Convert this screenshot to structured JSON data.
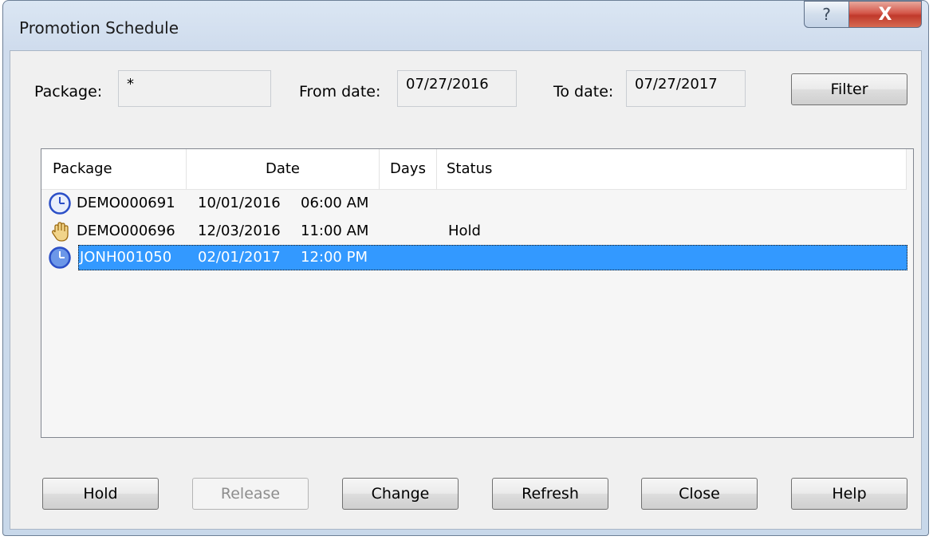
{
  "window": {
    "title": "Promotion Schedule",
    "help_glyph": "?",
    "close_glyph": "X"
  },
  "filters": {
    "package_label": "Package:",
    "package_value": "*",
    "from_label": "From date:",
    "from_value": "07/27/2016",
    "to_label": "To date:",
    "to_value": "07/27/2017",
    "filter_button": "Filter"
  },
  "table": {
    "columns": [
      "Package",
      "Date",
      "Days",
      "Status"
    ],
    "rows": [
      {
        "icon": "clock-icon",
        "package": "DEMO000691",
        "date": "10/01/2016",
        "time": "06:00 AM",
        "days": "",
        "status": ""
      },
      {
        "icon": "hand-hold-icon",
        "package": "DEMO000696",
        "date": "12/03/2016",
        "time": "11:00 AM",
        "days": "",
        "status": "Hold"
      },
      {
        "icon": "clock-icon",
        "package": "JONH001050",
        "date": "02/01/2017",
        "time": "12:00 PM",
        "days": "",
        "status": "",
        "selected": true
      }
    ]
  },
  "buttons": {
    "hold": "Hold",
    "release": "Release",
    "change": "Change",
    "refresh": "Refresh",
    "close": "Close",
    "help": "Help"
  },
  "colors": {
    "selection": "#3399ff",
    "close_button": "#c0392b"
  }
}
